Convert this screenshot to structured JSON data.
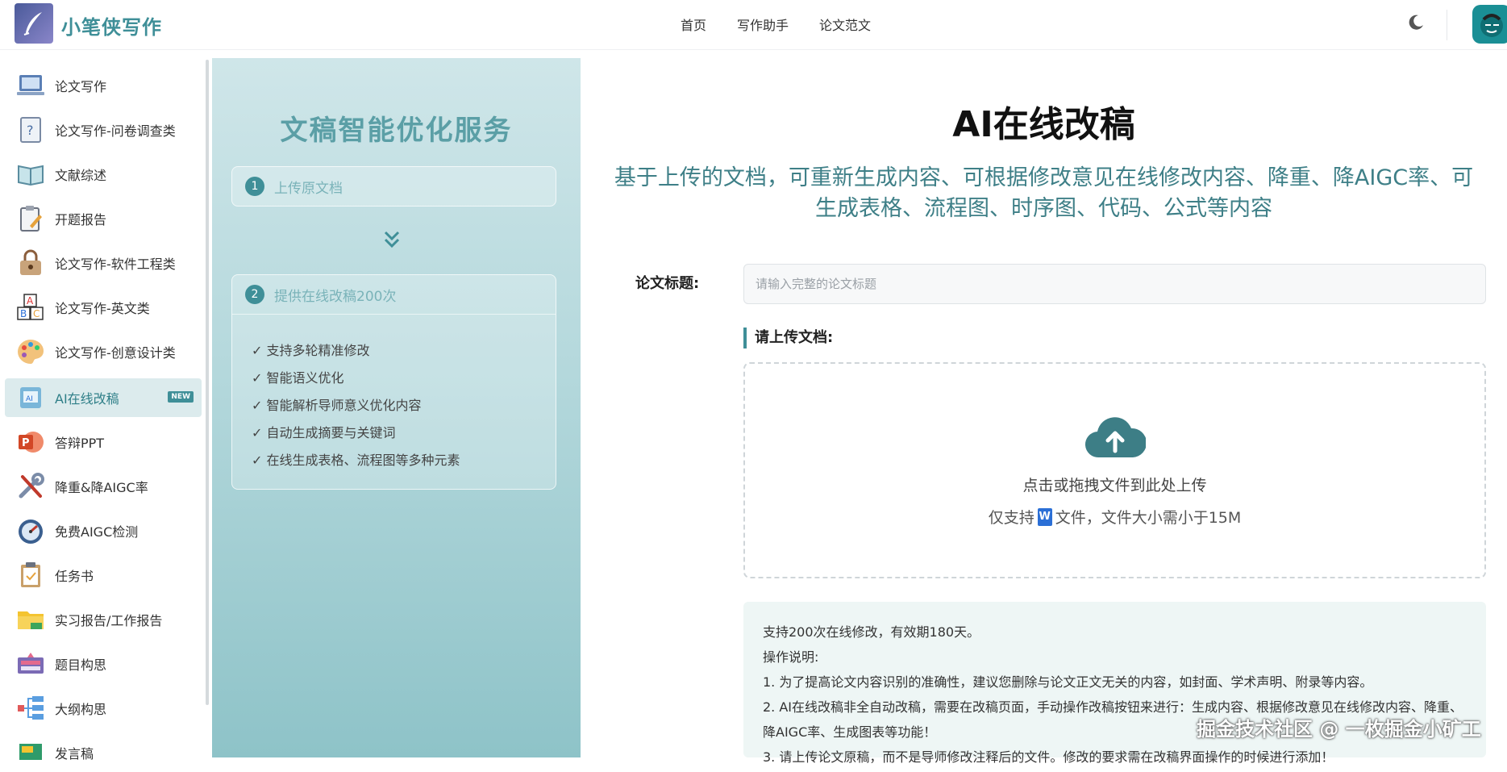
{
  "header": {
    "brand": "小笔侠写作",
    "nav": [
      "首页",
      "写作助手",
      "论文范文"
    ]
  },
  "sidebar": {
    "items": [
      {
        "label": "论文写作"
      },
      {
        "label": "论文写作-问卷调查类"
      },
      {
        "label": "文献综述"
      },
      {
        "label": "开题报告"
      },
      {
        "label": "论文写作-软件工程类"
      },
      {
        "label": "论文写作-英文类"
      },
      {
        "label": "论文写作-创意设计类"
      },
      {
        "label": "AI在线改稿",
        "active": true,
        "badge": "NEW"
      },
      {
        "label": "答辩PPT"
      },
      {
        "label": "降重&降AIGC率"
      },
      {
        "label": "免费AIGC检测"
      },
      {
        "label": "任务书"
      },
      {
        "label": "实习报告/工作报告"
      },
      {
        "label": "题目构思"
      },
      {
        "label": "大纲构思"
      },
      {
        "label": "发言稿"
      }
    ]
  },
  "panel": {
    "title": "文稿智能优化服务",
    "step1": {
      "num": "1",
      "label": "上传原文档"
    },
    "step2": {
      "num": "2",
      "label": "提供在线改稿200次"
    },
    "features": [
      "✓ 支持多轮精准修改",
      "✓ 智能语义优化",
      "✓ 智能解析导师意义优化内容",
      "✓ 自动生成摘要与关键词",
      "✓ 在线生成表格、流程图等多种元素"
    ]
  },
  "main": {
    "title": "AI在线改稿",
    "subtitle": "基于上传的文档，可重新生成内容、可根据修改意见在线修改内容、降重、降AIGC率、可生成表格、流程图、时序图、代码、公式等内容",
    "title_label": "论文标题:",
    "title_placeholder": "请输入完整的论文标题",
    "upload_label": "请上传文档:",
    "upload_main": "点击或拖拽文件到此处上传",
    "upload_sub_prefix": "仅支持",
    "upload_sub_icon": "W",
    "upload_sub_suffix": "文件，文件大小需小于15M",
    "notes": [
      "支持200次在线修改，有效期180天。",
      "操作说明:",
      "1. 为了提高论文内容识别的准确性，建议您删除与论文正文无关的内容，如封面、学术声明、附录等内容。",
      "2. AI在线改稿非全自动改稿，需要在改稿页面，手动操作改稿按钮来进行：生成内容、根据修改意见在线修改内容、降重、降AIGC率、生成图表等功能！",
      "3. 请上传论文原稿，而不是导师修改注释后的文件。修改的要求需在改稿界面操作的时候进行添加！"
    ]
  },
  "watermark": "掘金技术社区 @ 一枚掘金小矿工",
  "colors": {
    "accent": "#3f8f98"
  }
}
